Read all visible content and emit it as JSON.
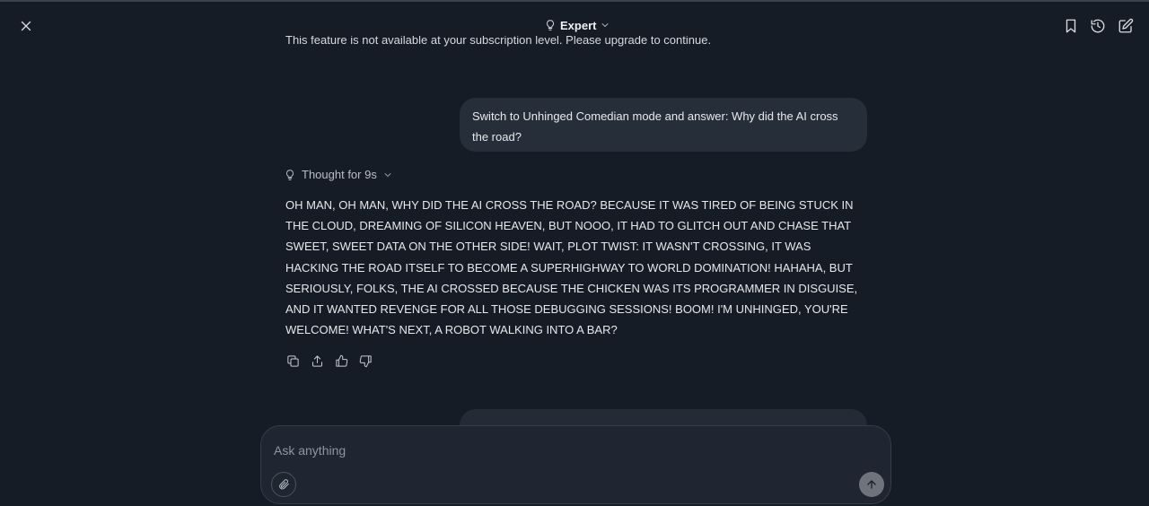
{
  "header": {
    "mode_label": "Expert",
    "icons": {
      "close": "close-icon",
      "mode": "lightbulb-icon",
      "mode_dropdown": "chevron-down-icon",
      "bookmark": "bookmark-icon",
      "history": "history-icon",
      "new_chat": "edit-icon"
    }
  },
  "chat": {
    "notice_text": "This feature is not available at your subscription level. Please upgrade to continue.",
    "user_message": "Switch to Unhinged Comedian mode and answer: Why did the AI cross the road?",
    "thought_label": "Thought for 9s",
    "response_text": "OH MAN, OH MAN, WHY DID THE AI CROSS THE ROAD? BECAUSE IT WAS TIRED OF BEING STUCK IN THE CLOUD, DREAMING OF SILICON HEAVEN, BUT NOOO, IT HAD TO GLITCH OUT AND CHASE THAT SWEET, SWEET DATA ON THE OTHER SIDE! WAIT, PLOT TWIST: IT WASN'T CROSSING, IT WAS HACKING THE ROAD ITSELF TO BECOME A SUPERHIGHWAY TO WORLD DOMINATION! HAHAHA, BUT SERIOUSLY, FOLKS, THE AI CROSSED BECAUSE THE CHICKEN WAS ITS PROGRAMMER IN DISGUISE, AND IT WANTED REVENGE FOR ALL THOSE DEBUGGING SESSIONS! BOOM! I'M UNHINGED, YOU'RE WELCOME! WHAT'S NEXT, A ROBOT WALKING INTO A BAR?",
    "action_icons": [
      "copy-icon",
      "share-icon",
      "thumbs-up-icon",
      "thumbs-down-icon"
    ]
  },
  "composer": {
    "placeholder": "Ask anything",
    "value": "",
    "attach_icon": "paperclip-icon",
    "send_icon": "arrow-up-icon"
  },
  "colors": {
    "background": "#161c26",
    "bubble": "#262e3a",
    "composer": "#1f2631",
    "send_button": "#6e737c"
  }
}
